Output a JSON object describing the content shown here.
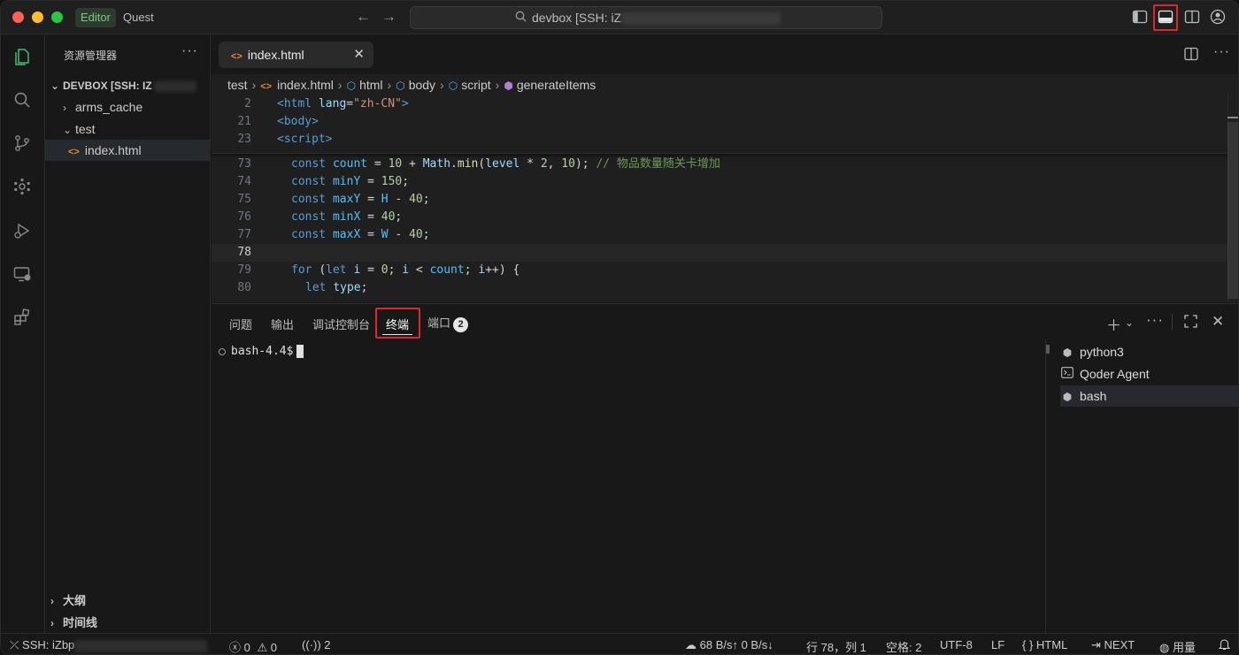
{
  "titlebar": {
    "mode_editor": "Editor",
    "mode_quest": "Quest",
    "search_text": "devbox [SSH: iZ"
  },
  "sidebar": {
    "title": "资源管理器",
    "more": "···",
    "root_label": "DEVBOX [SSH: IZ",
    "items": [
      {
        "label": "arms_cache"
      },
      {
        "label": "test"
      },
      {
        "label": "index.html"
      }
    ],
    "outline_label": "大纲",
    "timeline_label": "时间线"
  },
  "editor": {
    "tab_label": "index.html",
    "breadcrumb": [
      "test",
      "index.html",
      "html",
      "body",
      "script",
      "generateItems"
    ],
    "sticky": [
      {
        "ln": "2"
      },
      {
        "ln": "21"
      },
      {
        "ln": "23"
      }
    ],
    "lines": [
      {
        "ln": "73"
      },
      {
        "ln": "74"
      },
      {
        "ln": "75"
      },
      {
        "ln": "76"
      },
      {
        "ln": "77"
      },
      {
        "ln": "78"
      },
      {
        "ln": "79"
      },
      {
        "ln": "80"
      }
    ],
    "comment_73": "// 物品数量随关卡增加"
  },
  "panel": {
    "tabs": [
      "问题",
      "输出",
      "调试控制台",
      "终端",
      "端口"
    ],
    "ports_badge": "2",
    "prompt": "bash-4.4$",
    "terminals": [
      {
        "label": "python3",
        "icon": "cube-icon"
      },
      {
        "label": "Qoder Agent",
        "icon": "terminal-icon"
      },
      {
        "label": "bash",
        "icon": "cube-icon"
      }
    ]
  },
  "statusbar": {
    "remote": "SSH: iZbp",
    "errors": "0",
    "warnings": "0",
    "ports": "2",
    "network": "68 B/s↑ 0 B/s↓",
    "position": "行 78，列 1",
    "spaces": "空格: 2",
    "encoding": "UTF-8",
    "eol": "LF",
    "language": "HTML",
    "next": "NEXT",
    "usage": "用量"
  },
  "colors": {
    "accent_green": "#3fbf6b",
    "highlight_red": "#e0262d",
    "background": "#181818"
  }
}
